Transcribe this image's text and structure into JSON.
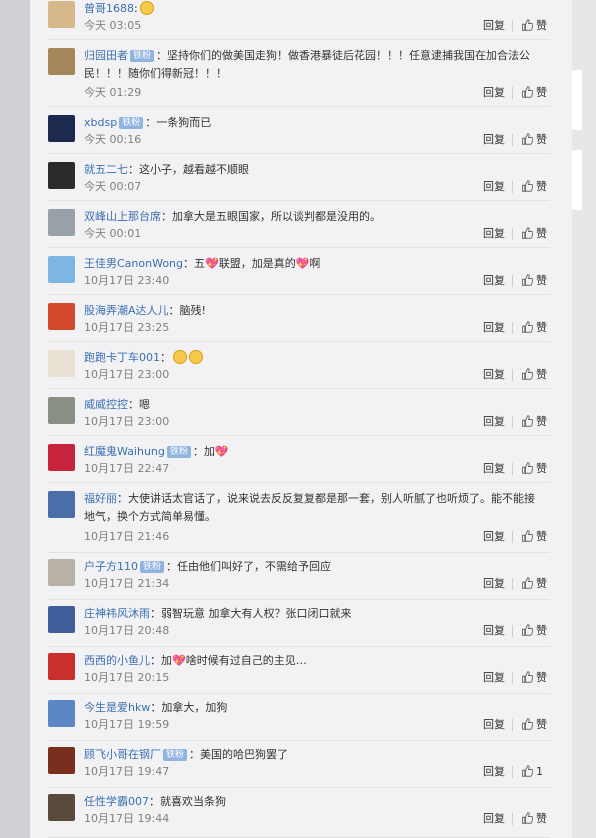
{
  "reply_label": "回复",
  "like_label": "赞",
  "badge_label": "铁粉",
  "colors": {
    "username": "#3a6fb0",
    "badge": "#8fb4e0",
    "time": "#808080",
    "panel": "#f2f2f5"
  },
  "comments": [
    {
      "user": "曾哥1688",
      "text": ":",
      "time": "今天 03:05",
      "like": "赞",
      "emoji": [
        "hand-emoji"
      ]
    },
    {
      "user": "归园田者",
      "badge": true,
      "text": "：坚持你们的做美国走狗！做香港暴徒后花园！！！任意逮捕我国在加合法公民！！！随你们得新冠！！！",
      "time": "今天 01:29",
      "like": "赞"
    },
    {
      "user": "xbdsp",
      "badge": true,
      "text": "：一条狗而已",
      "time": "今天 00:16",
      "like": "赞"
    },
    {
      "user": "就五二七",
      "text": "：这小子，越看越不顺眼",
      "time": "今天 00:07",
      "like": "赞"
    },
    {
      "user": "双峰山上那台席",
      "text": "：加拿大是五眼国家，所以谈判都是没用的。",
      "time": "今天 00:01",
      "like": "赞"
    },
    {
      "user": "王佳男CanonWong",
      "text": "：五💖联盟，加是真的💖啊",
      "time": "10月17日 23:40",
      "like": "赞"
    },
    {
      "user": "股海弄潮A达人儿",
      "text": "：脑残!",
      "time": "10月17日 23:25",
      "like": "赞"
    },
    {
      "user": "跑跑卡丁车001",
      "text": "：",
      "time": "10月17日 23:00",
      "like": "赞",
      "emoji": [
        "smile-emoji",
        "smile-emoji"
      ]
    },
    {
      "user": "威威控控",
      "text": "：嗯",
      "time": "10月17日 23:00",
      "like": "赞"
    },
    {
      "user": "红魔鬼Waihung",
      "badge": true,
      "text": "：加💖",
      "time": "10月17日 22:47",
      "like": "赞"
    },
    {
      "user": "福好丽",
      "text": "：大使讲话太官话了，说来说去反反复复都是那一套，别人听腻了也听烦了。能不能接地气，换个方式简单易懂。",
      "time": "10月17日 21:46",
      "like": "赞"
    },
    {
      "user": "户子方110",
      "badge": true,
      "text": "：任由他们叫好了，不需给予回应",
      "time": "10月17日 21:34",
      "like": "赞"
    },
    {
      "user": "庄神祎风沐雨",
      "text": "：弱智玩意 加拿大有人权？张口闭口就来",
      "time": "10月17日 20:48",
      "like": "赞"
    },
    {
      "user": "西西的小鱼儿",
      "text": "：加💖啥时候有过自己的主见…",
      "time": "10月17日 20:15",
      "like": "赞"
    },
    {
      "user": "今生是爱hkw",
      "text": "：加拿大，加狗",
      "time": "10月17日 19:59",
      "like": "赞"
    },
    {
      "user": "顾飞小哥在钢厂",
      "badge": true,
      "text": "：美国的哈巴狗罢了",
      "time": "10月17日 19:47",
      "like": "1"
    },
    {
      "user": "任性学霸007",
      "text": "：就喜欢当条狗",
      "time": "10月17日 19:44",
      "like": "赞"
    }
  ]
}
